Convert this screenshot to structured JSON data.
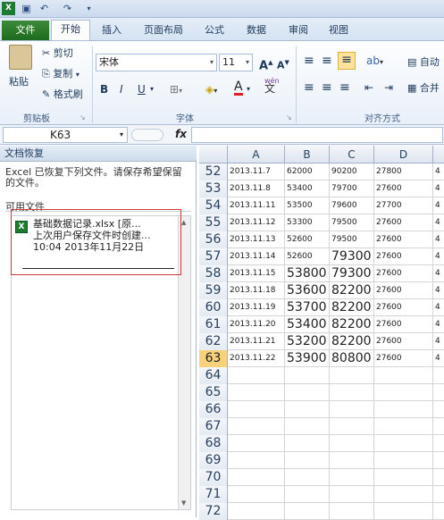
{
  "ribbon_tabs": [
    "文件",
    "开始",
    "插入",
    "页面布局",
    "公式",
    "数据",
    "审阅",
    "视图"
  ],
  "clipboard": {
    "paste": "粘贴",
    "cut": "剪切",
    "copy": "复制",
    "format_painter": "格式刷",
    "label": "剪贴板"
  },
  "font": {
    "name": "宋体",
    "size": "11",
    "bold": "B",
    "italic": "I",
    "underline": "U",
    "label": "字体",
    "wen": "wén",
    "font_a": "A"
  },
  "align": {
    "label": "对齐方式",
    "wrap": "自动",
    "merge": "合并"
  },
  "formula_bar": {
    "name_box": "K63",
    "fx": "fx"
  },
  "recovery": {
    "title": "文档恢复",
    "message": "Excel 已恢复下列文件。请保存希望保留的文件。",
    "available": "可用文件",
    "file": {
      "name": "基础数据记录.xlsx [原...",
      "desc": "上次用户保存文件时创建...",
      "time": "10:04 2013年11月22日"
    }
  },
  "columns": [
    "A",
    "B",
    "C",
    "D",
    ""
  ],
  "rows": [
    {
      "n": "52",
      "a": "2013.11.7",
      "b": "62000",
      "c": "90200",
      "d": "27800",
      "e": "4",
      "big": false
    },
    {
      "n": "53",
      "a": "2013.11.8",
      "b": "53400",
      "c": "79700",
      "d": "27600",
      "e": "4",
      "big": false
    },
    {
      "n": "54",
      "a": "2013.11.11",
      "b": "53500",
      "c": "79600",
      "d": "27700",
      "e": "4",
      "big": false
    },
    {
      "n": "55",
      "a": "2013.11.12",
      "b": "53300",
      "c": "79500",
      "d": "27600",
      "e": "4",
      "big": false
    },
    {
      "n": "56",
      "a": "2013.11.13",
      "b": "52600",
      "c": "79500",
      "d": "27600",
      "e": "4",
      "big": false
    },
    {
      "n": "57",
      "a": "2013.11.14",
      "b": "52600",
      "c": "79300",
      "d": "27600",
      "e": "4",
      "big": "c"
    },
    {
      "n": "58",
      "a": "2013.11.15",
      "b": "53800",
      "c": "79300",
      "d": "27600",
      "e": "4",
      "big": "bc"
    },
    {
      "n": "59",
      "a": "2013.11.18",
      "b": "53600",
      "c": "82200",
      "d": "27600",
      "e": "4",
      "big": "bc"
    },
    {
      "n": "60",
      "a": "2013.11.19",
      "b": "53700",
      "c": "82200",
      "d": "27600",
      "e": "4",
      "big": "bc"
    },
    {
      "n": "61",
      "a": "2013.11.20",
      "b": "53400",
      "c": "82200",
      "d": "27600",
      "e": "4",
      "big": "bc"
    },
    {
      "n": "62",
      "a": "2013.11.21",
      "b": "53200",
      "c": "82200",
      "d": "27600",
      "e": "4",
      "big": "bc"
    },
    {
      "n": "63",
      "a": "2013.11.22",
      "b": "53900",
      "c": "80800",
      "d": "27600",
      "e": "4",
      "big": "bc"
    },
    {
      "n": "64"
    },
    {
      "n": "65"
    },
    {
      "n": "66"
    },
    {
      "n": "67"
    },
    {
      "n": "68"
    },
    {
      "n": "69"
    },
    {
      "n": "70"
    },
    {
      "n": "71"
    },
    {
      "n": "72"
    }
  ],
  "selected_row": "63",
  "colors": {
    "file_tab": "#2a7d2c",
    "selection": "#f7d27a",
    "highlight_box": "#d23a3a"
  }
}
